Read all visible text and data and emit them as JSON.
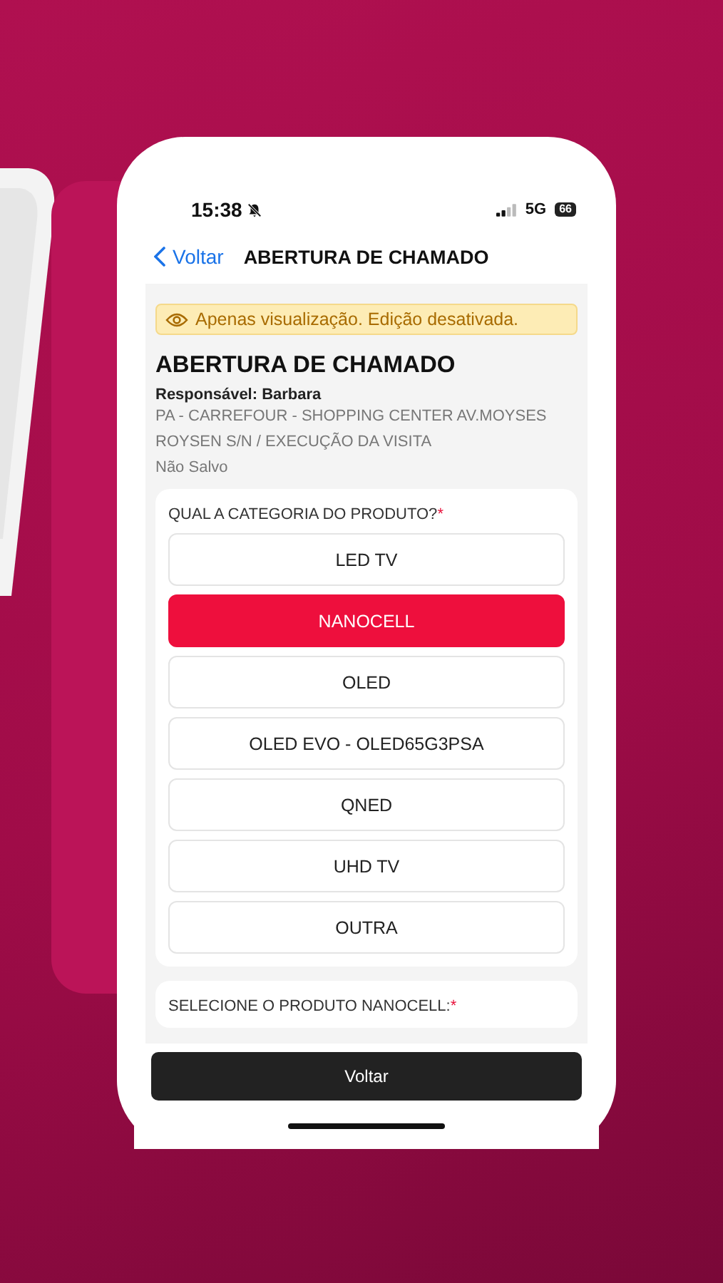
{
  "status_bar": {
    "time": "15:38",
    "silent": true,
    "network": "5G",
    "battery": "66"
  },
  "nav": {
    "back_label": "Voltar",
    "title": "ABERTURA DE CHAMADO"
  },
  "notice": {
    "text": "Apenas visualização. Edição desativada."
  },
  "header": {
    "title": "ABERTURA DE CHAMADO",
    "responsible": "Responsável: Barbara",
    "location": "PA - CARREFOUR - SHOPPING CENTER AV.MOYSES ROYSEN S/N / EXECUÇÃO DA VISITA",
    "save_status": "Não Salvo"
  },
  "questions": [
    {
      "label": "QUAL A CATEGORIA DO PRODUTO?",
      "required_mark": "*",
      "options": [
        {
          "label": "LED TV",
          "selected": false
        },
        {
          "label": "NANOCELL",
          "selected": true
        },
        {
          "label": "OLED",
          "selected": false
        },
        {
          "label": "OLED EVO - OLED65G3PSA",
          "selected": false
        },
        {
          "label": "QNED",
          "selected": false
        },
        {
          "label": "UHD TV",
          "selected": false
        },
        {
          "label": "OUTRA",
          "selected": false
        }
      ]
    },
    {
      "label": "SELECIONE O PRODUTO NANOCELL:",
      "required_mark": "*"
    }
  ],
  "bottom_button": "Voltar"
}
